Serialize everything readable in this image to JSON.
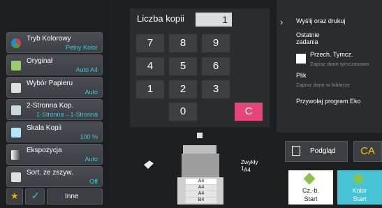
{
  "copy": {
    "title": "Liczba kopii",
    "count": "1",
    "keys": [
      "7",
      "8",
      "9",
      "4",
      "5",
      "6",
      "1",
      "2",
      "3",
      "0"
    ],
    "clear": "C"
  },
  "functions": [
    {
      "label": "Tryb Kolorowy",
      "value": "Pełny Kolor"
    },
    {
      "label": "Oryginał",
      "value": "Auto A4"
    },
    {
      "label": "Wybór Papieru",
      "value": "Auto"
    },
    {
      "label": "2-Stronna Kop.",
      "value": "1-Stronna→1-Stronna"
    },
    {
      "label": "Skala Kopii",
      "value": "100 %"
    },
    {
      "label": "Ekspozycja",
      "value": "Auto"
    },
    {
      "label": "Sort. ze zszyw.",
      "value": "Off"
    }
  ],
  "bottom": {
    "other": "Inne"
  },
  "right_panel": {
    "send_print": "Wyślij oraz drukuj",
    "recent": "Ostatnie\nzadania",
    "temp_save": "Przech. Tymcz.",
    "temp_save_sub": "Zapisz dane tymczasowo",
    "file": "Plik",
    "file_sub": "Zapisz dane w folderze",
    "eco": "Przywołaj program Eko"
  },
  "machine": {
    "paper_type": "Zwykły 1",
    "paper_size": "A4",
    "trays": [
      "A4",
      "A4",
      "A4",
      "B4"
    ]
  },
  "actions": {
    "preview": "Podgląd",
    "ca": "CA",
    "bw_start_1": "Cz.-b.",
    "bw_start_2": "Start",
    "color_start_1": "Kolor",
    "color_start_2": "Start"
  }
}
